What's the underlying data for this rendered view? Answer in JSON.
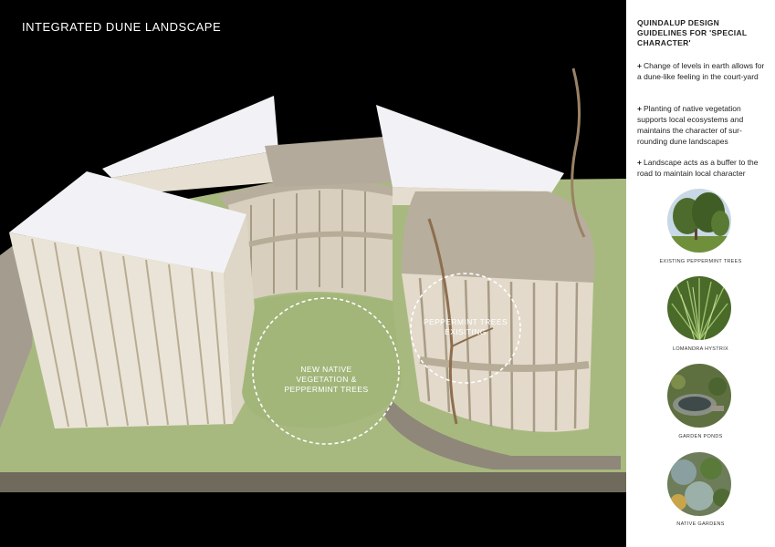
{
  "title": "INTEGRATED DUNE LANDSCAPE",
  "circles": {
    "left": "NEW NATIVE\nVEGETATION &\nPEPPERMINT TREES",
    "right": "PEPPERMINT TREES\nEXISITING"
  },
  "guidelines": {
    "heading": "QUINDALUP DESIGN GUIDELINES FOR 'SPECIAL CHARACTER'",
    "bullet_symbol": "+",
    "bullets": [
      "Change of levels in earth allows for a dune-like feeling in the court-yard",
      "Planting of native vegetation supports local ecosystems and maintains the character of sur-rounding dune landscapes",
      "Landscape acts as a buffer to the road to maintain local character"
    ]
  },
  "thumbnails": [
    {
      "caption": "EXISTING PEPPERMINT TREES",
      "icon": "peppermint-tree-photo"
    },
    {
      "caption": "LOMANDRA HYSTRIX",
      "icon": "grass-photo"
    },
    {
      "caption": "GARDEN PONDS",
      "icon": "pond-photo"
    },
    {
      "caption": "NATIVE GARDENS",
      "icon": "native-garden-photo"
    }
  ],
  "colors": {
    "background": "#000000",
    "panel": "#ffffff",
    "grass": "#a8b97f",
    "cardboard": "#b3aa9c",
    "roof": "#f2f2f6"
  }
}
